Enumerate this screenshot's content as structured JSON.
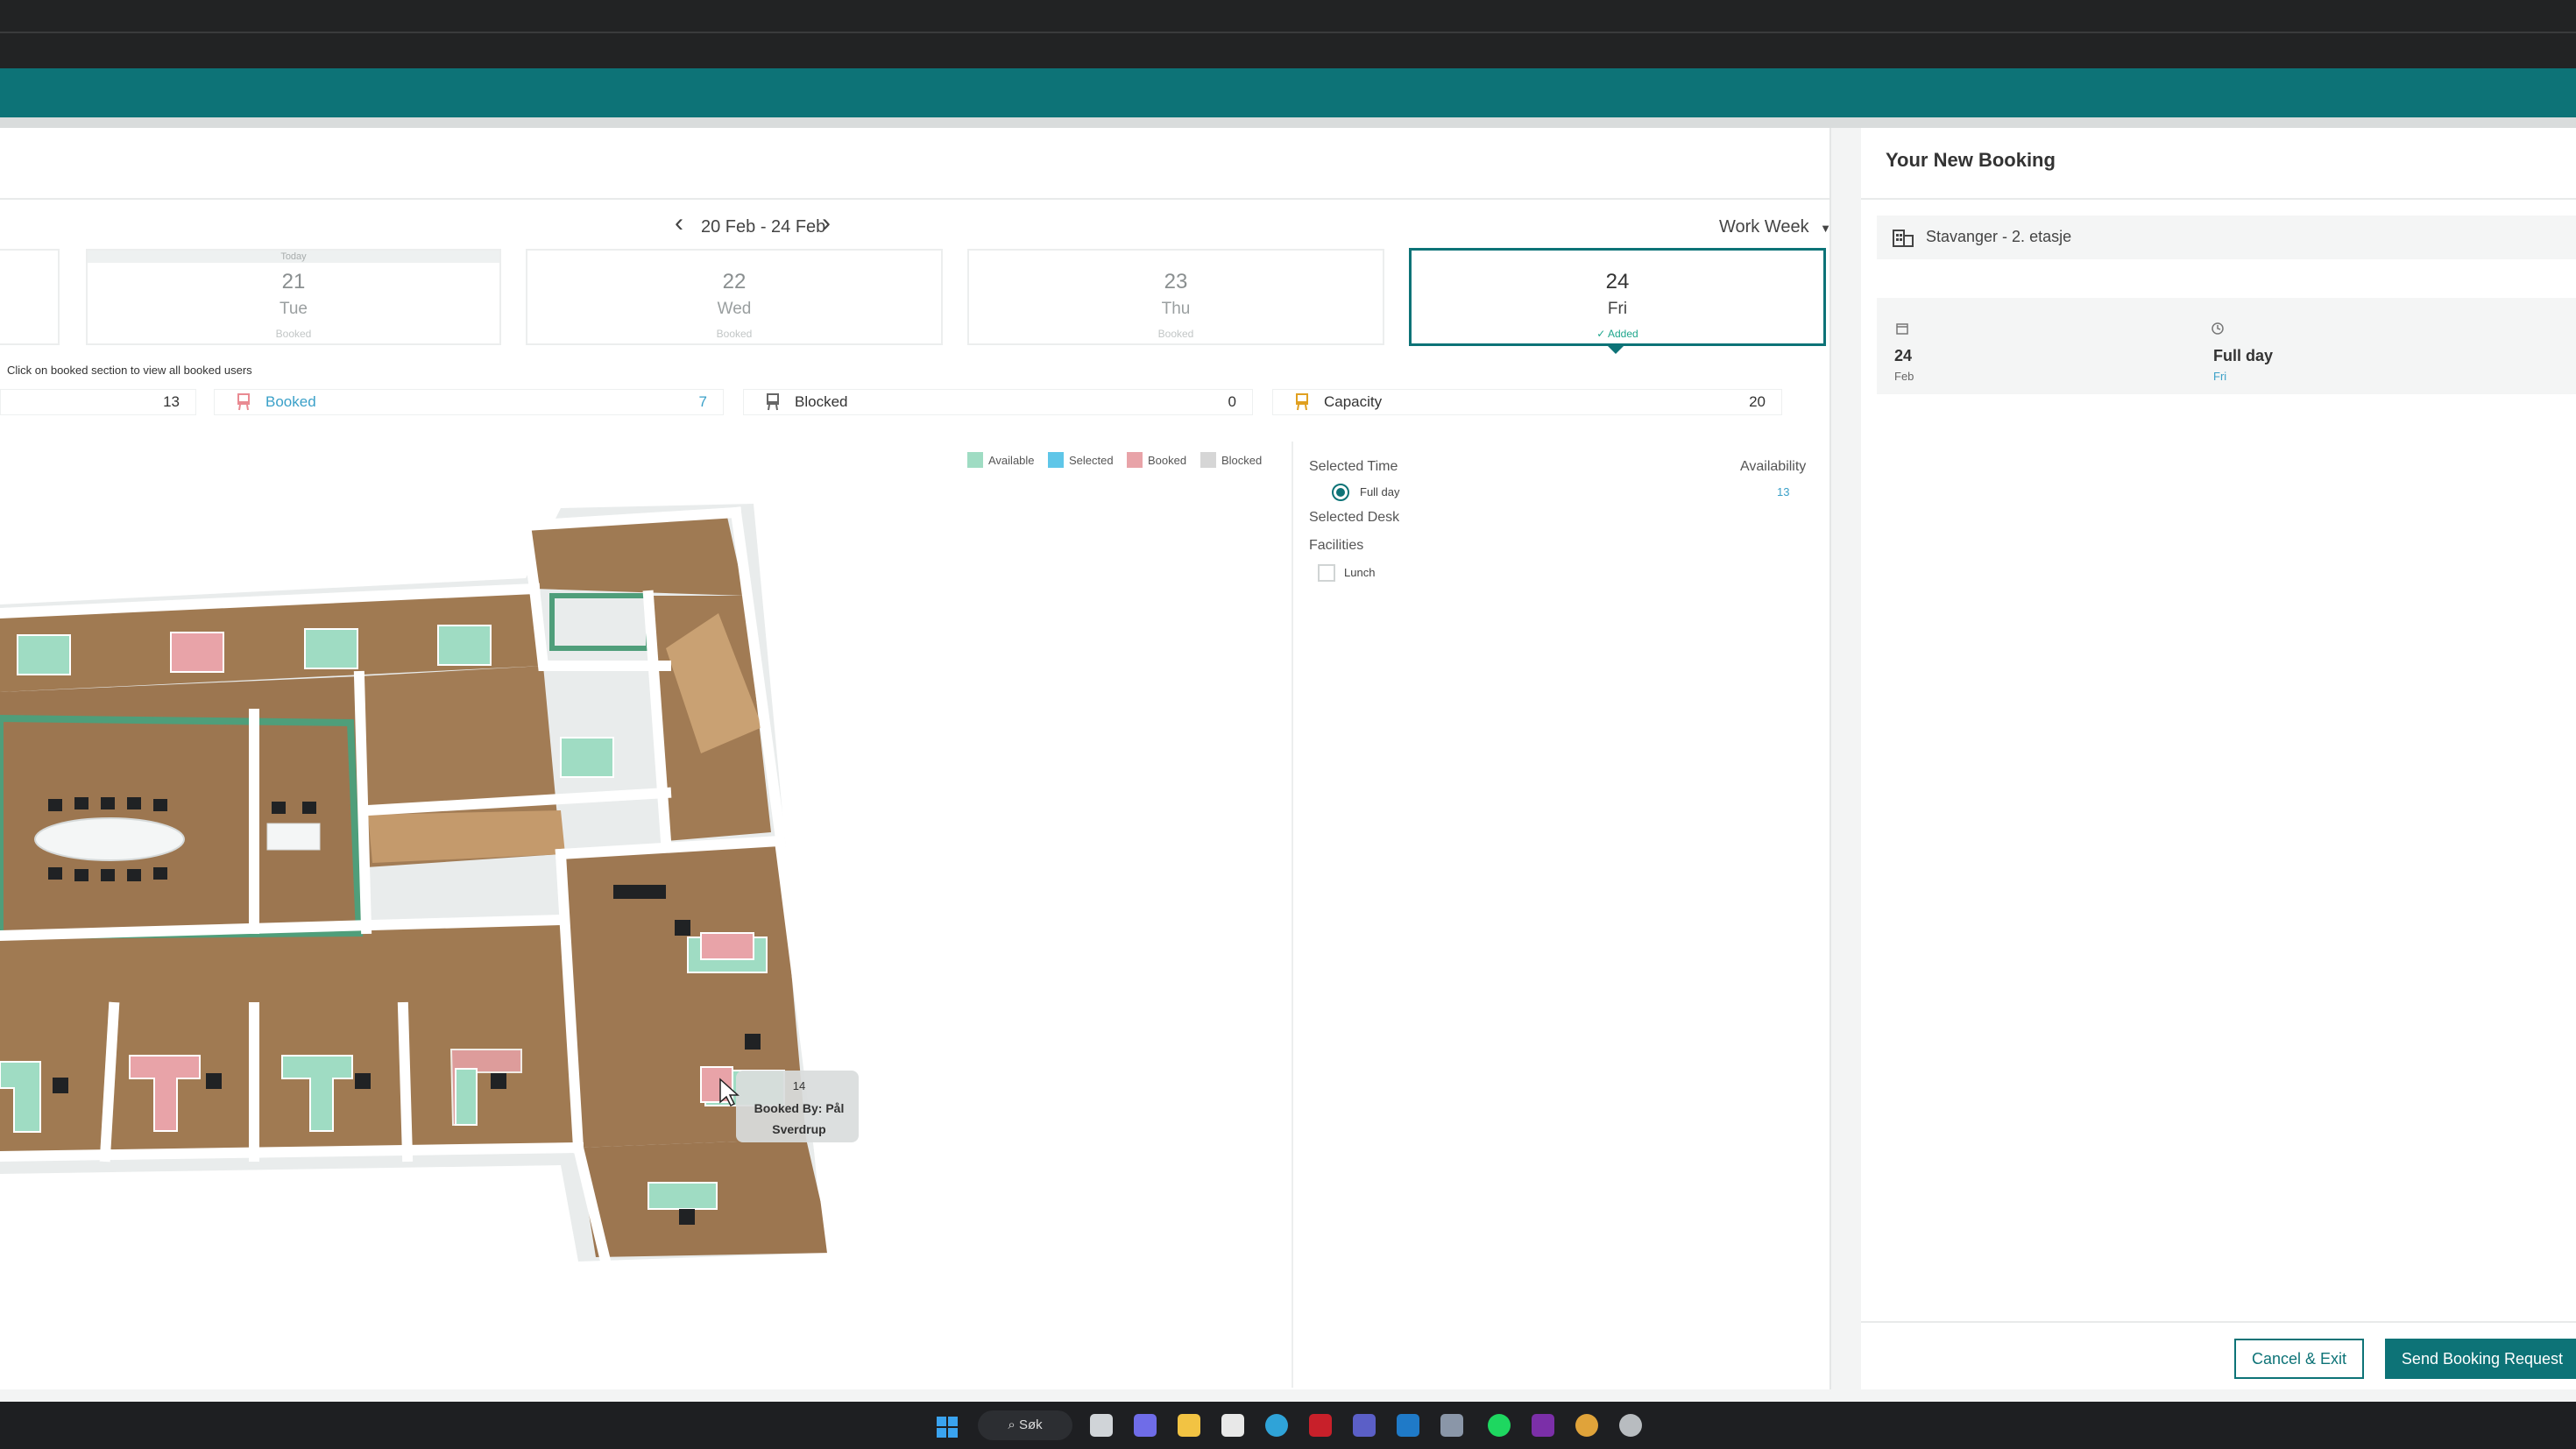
{
  "calendar": {
    "date_range": "20 Feb - 24 Feb",
    "view": "Work Week",
    "days": [
      {
        "num": "21",
        "dow": "Tue",
        "status": "Booked",
        "today_label": "Today"
      },
      {
        "num": "22",
        "dow": "Wed",
        "status": "Booked"
      },
      {
        "num": "23",
        "dow": "Thu",
        "status": "Booked"
      },
      {
        "num": "24",
        "dow": "Fri",
        "status": "✓ Added"
      }
    ]
  },
  "hint": "Click on booked section to view all booked users",
  "stats": {
    "available_value": "13",
    "booked_label": "Booked",
    "booked_value": "7",
    "blocked_label": "Blocked",
    "blocked_value": "0",
    "capacity_label": "Capacity",
    "capacity_value": "20"
  },
  "legend": {
    "available": "Available",
    "selected": "Selected",
    "booked": "Booked",
    "blocked": "Blocked",
    "colors": {
      "available": "#9fdcc3",
      "selected": "#5fc6e8",
      "booked": "#e8a3a8",
      "blocked": "#d6d6d6"
    }
  },
  "side": {
    "selected_time_label": "Selected Time",
    "availability_label": "Availability",
    "full_day_label": "Full day",
    "availability_value": "13",
    "selected_desk_label": "Selected Desk",
    "facilities_label": "Facilities",
    "lunch_label": "Lunch"
  },
  "tooltip": {
    "desk": "14",
    "line1": "Booked By: Pål",
    "line2": "Sverdrup"
  },
  "booking": {
    "title": "Your New Booking",
    "location": "Stavanger - 2. etasje",
    "date_num": "24",
    "date_month": "Feb",
    "time_label": "Full day",
    "time_day": "Fri",
    "cancel_label": "Cancel & Exit",
    "send_label": "Send Booking Request"
  },
  "taskbar": {
    "search_label": "Søk"
  }
}
